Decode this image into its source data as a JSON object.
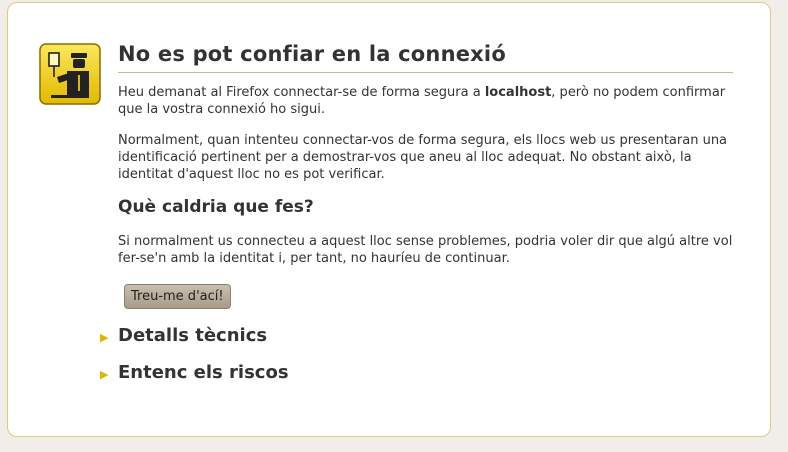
{
  "title": "No es pot confiar en la connexió",
  "intro": {
    "before": "Heu demanat al Firefox connectar-se de forma segura a ",
    "host": "localhost",
    "after": ", però no podem confirmar que la vostra connexió ho sigui."
  },
  "explanation": "Normalment, quan intenteu connectar-vos de forma segura, els llocs web us presentaran una identificació pertinent per a demostrar-vos que aneu al lloc adequat. No obstant això, la identitat d'aquest lloc no es pot verificar.",
  "what_heading": "Què caldria que fes?",
  "what_text": "Si normalment us connecteu a aquest lloc sense problemes, podria voler dir que algú altre vol fer-se'n amb la identitat i, per tant, no hauríeu de continuar.",
  "button_label": "Treu-me d'ací!",
  "expanders": [
    {
      "label": "Detalls tècnics",
      "icon": "triangle-right-icon"
    },
    {
      "label": "Entenc els riscos",
      "icon": "triangle-right-icon"
    }
  ],
  "colors": {
    "accent": "#e0b400",
    "border": "#e3c97a",
    "button": "#b5aa96"
  }
}
